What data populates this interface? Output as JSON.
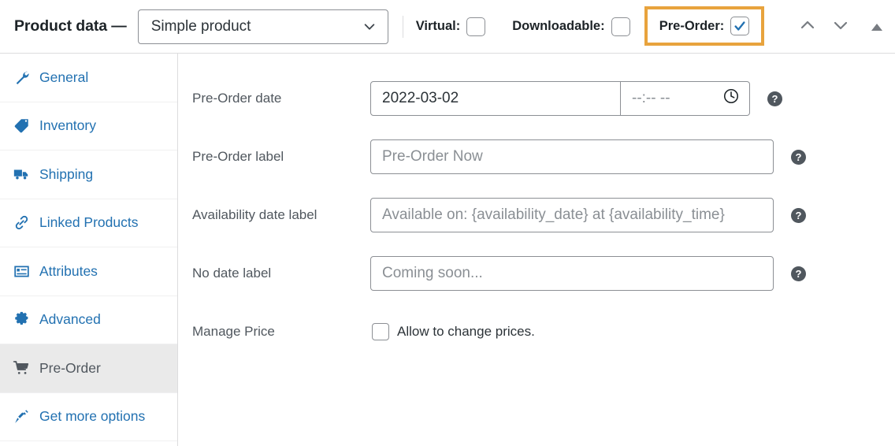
{
  "header": {
    "title": "Product data —",
    "product_type": "Simple product",
    "chevron_icon": "chevron-down-icon",
    "checkboxes": [
      {
        "label": "Virtual:",
        "checked": false,
        "name": "virtual"
      },
      {
        "label": "Downloadable:",
        "checked": false,
        "name": "downloadable"
      },
      {
        "label": "Pre-Order:",
        "checked": true,
        "name": "pre-order",
        "highlighted": true
      }
    ],
    "nav": [
      {
        "icon": "chevron-up-icon",
        "name": "move-up-button"
      },
      {
        "icon": "chevron-down-icon",
        "name": "move-down-button"
      },
      {
        "icon": "triangle-up-icon",
        "name": "toggle-panel-button"
      }
    ],
    "highlight_color": "#e8a33d"
  },
  "sidebar": {
    "items": [
      {
        "label": "General",
        "icon": "wrench-icon",
        "active": false
      },
      {
        "label": "Inventory",
        "icon": "tag-icon",
        "active": false
      },
      {
        "label": "Shipping",
        "icon": "truck-icon",
        "active": false
      },
      {
        "label": "Linked Products",
        "icon": "link-icon",
        "active": false
      },
      {
        "label": "Attributes",
        "icon": "list-icon",
        "active": false
      },
      {
        "label": "Advanced",
        "icon": "gear-icon",
        "active": false
      },
      {
        "label": "Pre-Order",
        "icon": "cart-icon",
        "active": true
      },
      {
        "label": "Get more options",
        "icon": "plug-icon",
        "active": false
      }
    ],
    "link_color": "#2271b1",
    "active_bg": "#eaeaea"
  },
  "fields": {
    "preorder_date": {
      "label": "Pre-Order date",
      "date_value": "2022-03-02",
      "date_placeholder": "",
      "time_value": "",
      "time_placeholder": "--:-- --",
      "time_icon": "clock-icon",
      "help": "?"
    },
    "preorder_label": {
      "label": "Pre-Order label",
      "value": "",
      "placeholder": "Pre-Order Now",
      "help": "?"
    },
    "availability_date_label": {
      "label": "Availability date label",
      "value": "",
      "placeholder": "Available on: {availability_date} at {availability_time}",
      "help": "?"
    },
    "no_date_label": {
      "label": "No date label",
      "value": "",
      "placeholder": "Coming soon...",
      "help": "?"
    },
    "manage_price": {
      "label": "Manage Price",
      "checkbox_label": "Allow to change prices.",
      "checked": false
    }
  }
}
